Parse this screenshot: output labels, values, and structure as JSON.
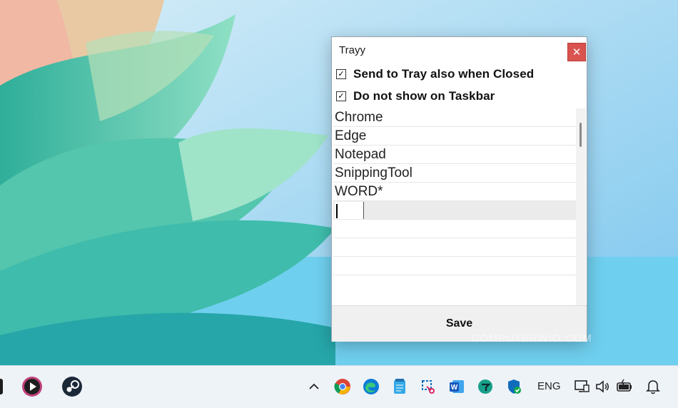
{
  "window": {
    "title": "Trayy",
    "close_glyph": "✕",
    "options": [
      {
        "label": "Send to Tray also when Closed",
        "checked": true
      },
      {
        "label": "Do not show on Taskbar",
        "checked": true
      }
    ],
    "apps": [
      "Chrome",
      "Edge",
      "Notepad",
      "SnippingTool",
      "WORD*",
      "",
      "",
      "",
      ""
    ],
    "save_label": "Save"
  },
  "watermark": "COMPUTERWIO.COM",
  "taskbar": {
    "language": "ENG",
    "icons": [
      "media-player-icon",
      "steam-icon",
      "chevron-up-icon",
      "chrome-icon",
      "edge-icon",
      "notepad-icon",
      "snipping-tool-icon",
      "word-icon",
      "app-icon",
      "defender-icon",
      "network-icon",
      "volume-icon",
      "battery-icon",
      "bell-icon"
    ]
  },
  "colors": {
    "close": "#d9534f",
    "taskbar": "#eef3f8",
    "accent": "#0f6cbd"
  }
}
